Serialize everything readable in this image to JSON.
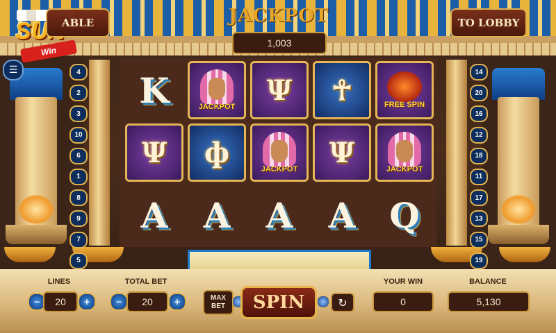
{
  "header": {
    "jackpot_title": "JACKPOT",
    "jackpot_value": "1,003",
    "paytable_label": "ABLE",
    "lobby_label": "TO LOBBY"
  },
  "logo": {
    "brand": "SUN",
    "sub": "Win"
  },
  "lines_left": [
    "4",
    "2",
    "3",
    "10",
    "6",
    "1",
    "8",
    "9",
    "7",
    "5"
  ],
  "lines_right": [
    "14",
    "20",
    "16",
    "12",
    "18",
    "11",
    "17",
    "13",
    "15",
    "19"
  ],
  "reels": [
    [
      "K",
      "jackpot",
      "chalice",
      "ankh",
      "freespin"
    ],
    [
      "chalice",
      "eye",
      "jackpot",
      "chalice",
      "jackpot"
    ],
    [
      "A",
      "A",
      "A",
      "A",
      "Q"
    ]
  ],
  "symbol_labels": {
    "jackpot": "JACKPOT",
    "freespin": "FREE SPIN"
  },
  "controls": {
    "lines_label": "LINES",
    "lines_value": "20",
    "total_bet_label": "TOTAL BET",
    "total_bet_value": "20",
    "max_bet_label": "MAX BET",
    "spin_label": "SPIN",
    "your_win_label": "YOUR WIN",
    "your_win_value": "0",
    "balance_label": "BALANCE",
    "balance_value": "5,130",
    "minus_glyph": "−",
    "plus_glyph": "+",
    "auto_glyph": "↻",
    "menu_glyph": "☰"
  },
  "colors": {
    "gold": "#e1b24c",
    "blue": "#1c5ea8",
    "purple": "#5a2a80",
    "panel": "#e6c98d"
  }
}
